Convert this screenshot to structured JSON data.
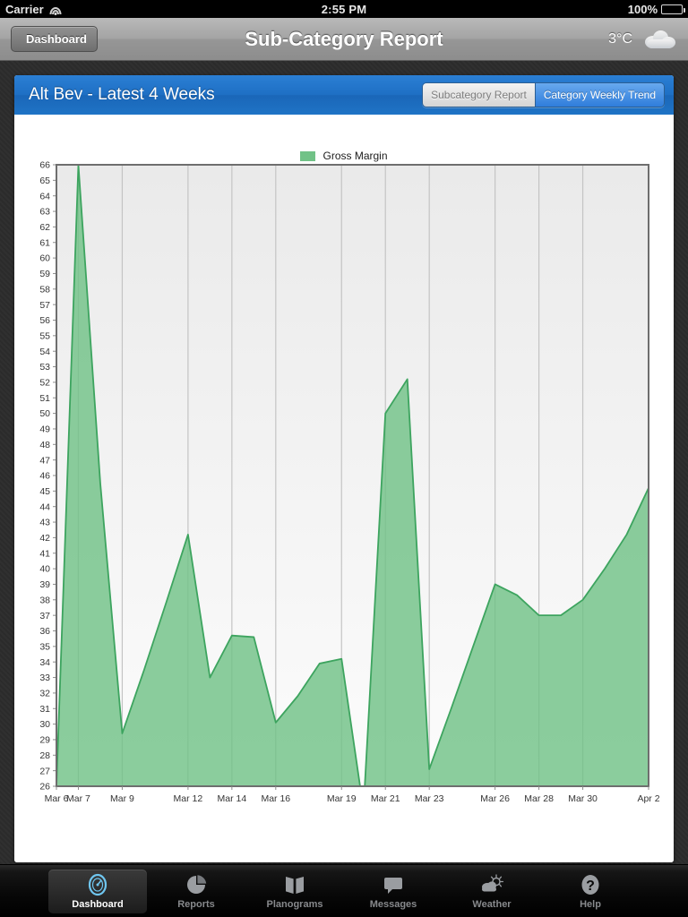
{
  "status_bar": {
    "carrier": "Carrier",
    "wifi_icon": "wifi-icon",
    "clock": "2:55 PM",
    "battery_percent": "100%",
    "battery_icon": "battery-full-icon"
  },
  "nav_bar": {
    "back_label": "Dashboard",
    "title": "Sub-Category Report",
    "temperature": "3°C",
    "weather_icon": "cloud-icon"
  },
  "panel": {
    "title": "Alt Bev - Latest 4 Weeks",
    "segments": [
      {
        "label": "Subcategory Report",
        "active": false
      },
      {
        "label": "Category Weekly Trend",
        "active": true
      }
    ]
  },
  "colors": {
    "accent_blue": "#1f74c6",
    "series_fill": "#71c287",
    "series_line": "#3da45f",
    "plot_bg": "#ededed",
    "gridline": "#c4c4c4"
  },
  "chart_data": {
    "type": "area",
    "title": "",
    "xlabel": "",
    "ylabel": "",
    "ylim": [
      26,
      66
    ],
    "grid": true,
    "legend_position": "top-center",
    "legend": [
      "Gross Margin"
    ],
    "y_ticks": [
      26,
      27,
      28,
      29,
      30,
      31,
      32,
      33,
      34,
      35,
      36,
      37,
      38,
      39,
      40,
      41,
      42,
      43,
      44,
      45,
      46,
      47,
      48,
      49,
      50,
      51,
      52,
      53,
      54,
      55,
      56,
      57,
      58,
      59,
      60,
      61,
      62,
      63,
      64,
      65,
      66
    ],
    "x_tick_labels": [
      "Mar 6",
      "Mar 7",
      "Mar 9",
      "Mar 12",
      "Mar 14",
      "Mar 16",
      "Mar 19",
      "Mar 21",
      "Mar 23",
      "Mar 26",
      "Mar 28",
      "Mar 30",
      "Apr 2"
    ],
    "x_tick_indices": [
      0,
      1,
      3,
      6,
      8,
      10,
      13,
      15,
      17,
      20,
      22,
      24,
      27
    ],
    "gridline_indices": [
      1,
      3,
      6,
      8,
      10,
      13,
      15,
      17,
      20,
      22,
      24
    ],
    "categories": [
      "Mar 6",
      "Mar 7",
      "Mar 8",
      "Mar 9",
      "Mar 10",
      "Mar 11",
      "Mar 12",
      "Mar 13",
      "Mar 14",
      "Mar 15",
      "Mar 16",
      "Mar 17",
      "Mar 18",
      "Mar 19",
      "Mar 20",
      "Mar 21",
      "Mar 22",
      "Mar 23",
      "Mar 24",
      "Mar 25",
      "Mar 26",
      "Mar 27",
      "Mar 28",
      "Mar 29",
      "Mar 30",
      "Mar 31",
      "Apr 1",
      "Apr 2"
    ],
    "series": [
      {
        "name": "Gross Margin",
        "values": [
          26.0,
          66.0,
          45.5,
          29.4,
          33.5,
          37.8,
          42.2,
          33.0,
          35.7,
          35.6,
          30.1,
          31.8,
          33.9,
          34.2,
          24.5,
          50.0,
          52.2,
          27.1,
          31.0,
          35.0,
          39.0,
          38.3,
          37.0,
          37.0,
          38.0,
          40.0,
          42.2,
          45.2
        ]
      }
    ]
  },
  "tab_bar": {
    "items": [
      {
        "label": "Dashboard",
        "icon": "gauge-icon",
        "active": true
      },
      {
        "label": "Reports",
        "icon": "pie-chart-icon",
        "active": false
      },
      {
        "label": "Planograms",
        "icon": "open-book-icon",
        "active": false
      },
      {
        "label": "Messages",
        "icon": "speech-bubble-icon",
        "active": false
      },
      {
        "label": "Weather",
        "icon": "sun-cloud-icon",
        "active": false
      },
      {
        "label": "Help",
        "icon": "question-mark-icon",
        "active": false
      }
    ]
  }
}
